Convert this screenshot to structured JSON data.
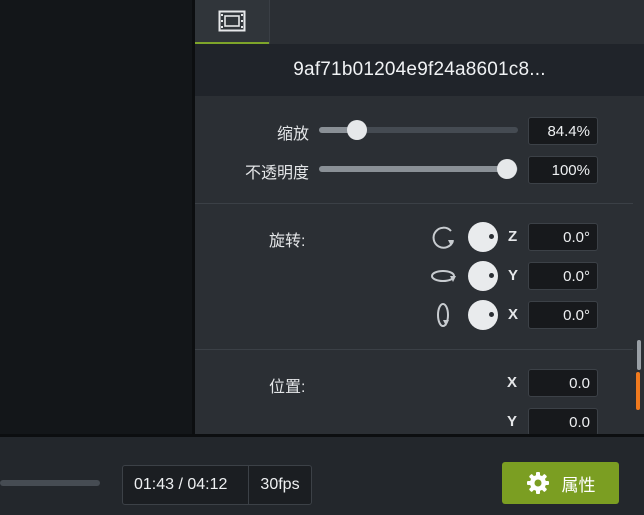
{
  "panel": {
    "tab_icon": "film-icon",
    "media_title": "9af71b01204e9f24a8601c8..."
  },
  "scale": {
    "label": "缩放",
    "value": "84.4%",
    "level": 0.084
  },
  "opacity": {
    "label": "不透明度",
    "value": "100%",
    "level": 1.0
  },
  "rotation": {
    "label": "旋转:",
    "axes": [
      {
        "axis": "Z",
        "value": "0.0°",
        "icon": "rotate-z-icon"
      },
      {
        "axis": "Y",
        "value": "0.0°",
        "icon": "rotate-y-icon"
      },
      {
        "axis": "X",
        "value": "0.0°",
        "icon": "rotate-x-icon"
      }
    ]
  },
  "position": {
    "label": "位置:",
    "axes": [
      {
        "axis": "X",
        "value": "0.0"
      },
      {
        "axis": "Y",
        "value": "0.0"
      }
    ]
  },
  "playback": {
    "time": "01:43 / 04:12",
    "fps": "30fps"
  },
  "properties_button": {
    "label": "属性",
    "icon": "gear-icon"
  },
  "colors": {
    "accent": "#7b9e22",
    "scroll_marker": "#f07a1e"
  }
}
